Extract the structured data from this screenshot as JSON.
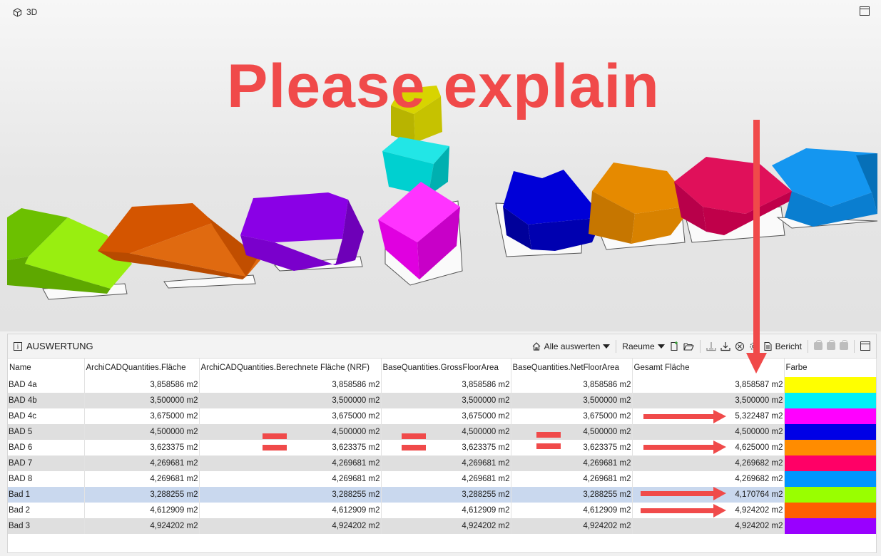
{
  "viewport": {
    "title": "3D",
    "annotation": "Please explain"
  },
  "panel": {
    "title": "AUSWERTUNG",
    "toolbar": {
      "evaluate_all": "Alle auswerten",
      "rooms": "Raeume",
      "report": "Bericht"
    },
    "columns": [
      "Name",
      "ArchiCADQuantities.Fläche",
      "ArchiCADQuantities.Berechnete Fläche (NRF)",
      "BaseQuantities.GrossFloorArea",
      "BaseQuantities.NetFloorArea",
      "Gesamt Fläche",
      "Farbe"
    ],
    "rows": [
      {
        "name": "BAD 4a",
        "flaeche": "3,858586 m2",
        "nrf": "3,858586 m2",
        "gross": "3,858586 m2",
        "net": "3,858586 m2",
        "gesamt": "3,858587 m2",
        "color": "#ffff00"
      },
      {
        "name": "BAD 4b",
        "flaeche": "3,500000 m2",
        "nrf": "3,500000 m2",
        "gross": "3,500000 m2",
        "net": "3,500000 m2",
        "gesamt": "3,500000 m2",
        "color": "#00f0f8"
      },
      {
        "name": "BAD 4c",
        "flaeche": "3,675000 m2",
        "nrf": "3,675000 m2",
        "gross": "3,675000 m2",
        "net": "3,675000 m2",
        "gesamt": "5,322487 m2",
        "color": "#ff00ff"
      },
      {
        "name": "BAD 5",
        "flaeche": "4,500000 m2",
        "nrf": "4,500000 m2",
        "gross": "4,500000 m2",
        "net": "4,500000 m2",
        "gesamt": "4,500000 m2",
        "color": "#0000e6"
      },
      {
        "name": "BAD 6",
        "flaeche": "3,623375 m2",
        "nrf": "3,623375 m2",
        "gross": "3,623375 m2",
        "net": "3,623375 m2",
        "gesamt": "4,625000 m2",
        "color": "#ff8c00"
      },
      {
        "name": "BAD 7",
        "flaeche": "4,269681 m2",
        "nrf": "4,269681 m2",
        "gross": "4,269681 m2",
        "net": "4,269681 m2",
        "gesamt": "4,269682 m2",
        "color": "#ff0066"
      },
      {
        "name": "BAD 8",
        "flaeche": "4,269681 m2",
        "nrf": "4,269681 m2",
        "gross": "4,269681 m2",
        "net": "4,269681 m2",
        "gesamt": "4,269682 m2",
        "color": "#0096ff"
      },
      {
        "name": "Bad 1",
        "flaeche": "3,288255 m2",
        "nrf": "3,288255 m2",
        "gross": "3,288255 m2",
        "net": "3,288255 m2",
        "gesamt": "4,170764 m2",
        "color": "#99ff00",
        "selected": true
      },
      {
        "name": "Bad 2",
        "flaeche": "4,612909 m2",
        "nrf": "4,612909 m2",
        "gross": "4,612909 m2",
        "net": "4,612909 m2",
        "gesamt": "4,924202 m2",
        "color": "#ff5f00"
      },
      {
        "name": "Bad 3",
        "flaeche": "4,924202 m2",
        "nrf": "4,924202 m2",
        "gross": "4,924202 m2",
        "net": "4,924202 m2",
        "gesamt": "4,924202 m2",
        "color": "#9900ff"
      }
    ]
  },
  "annotation_color": "#f04a4a"
}
